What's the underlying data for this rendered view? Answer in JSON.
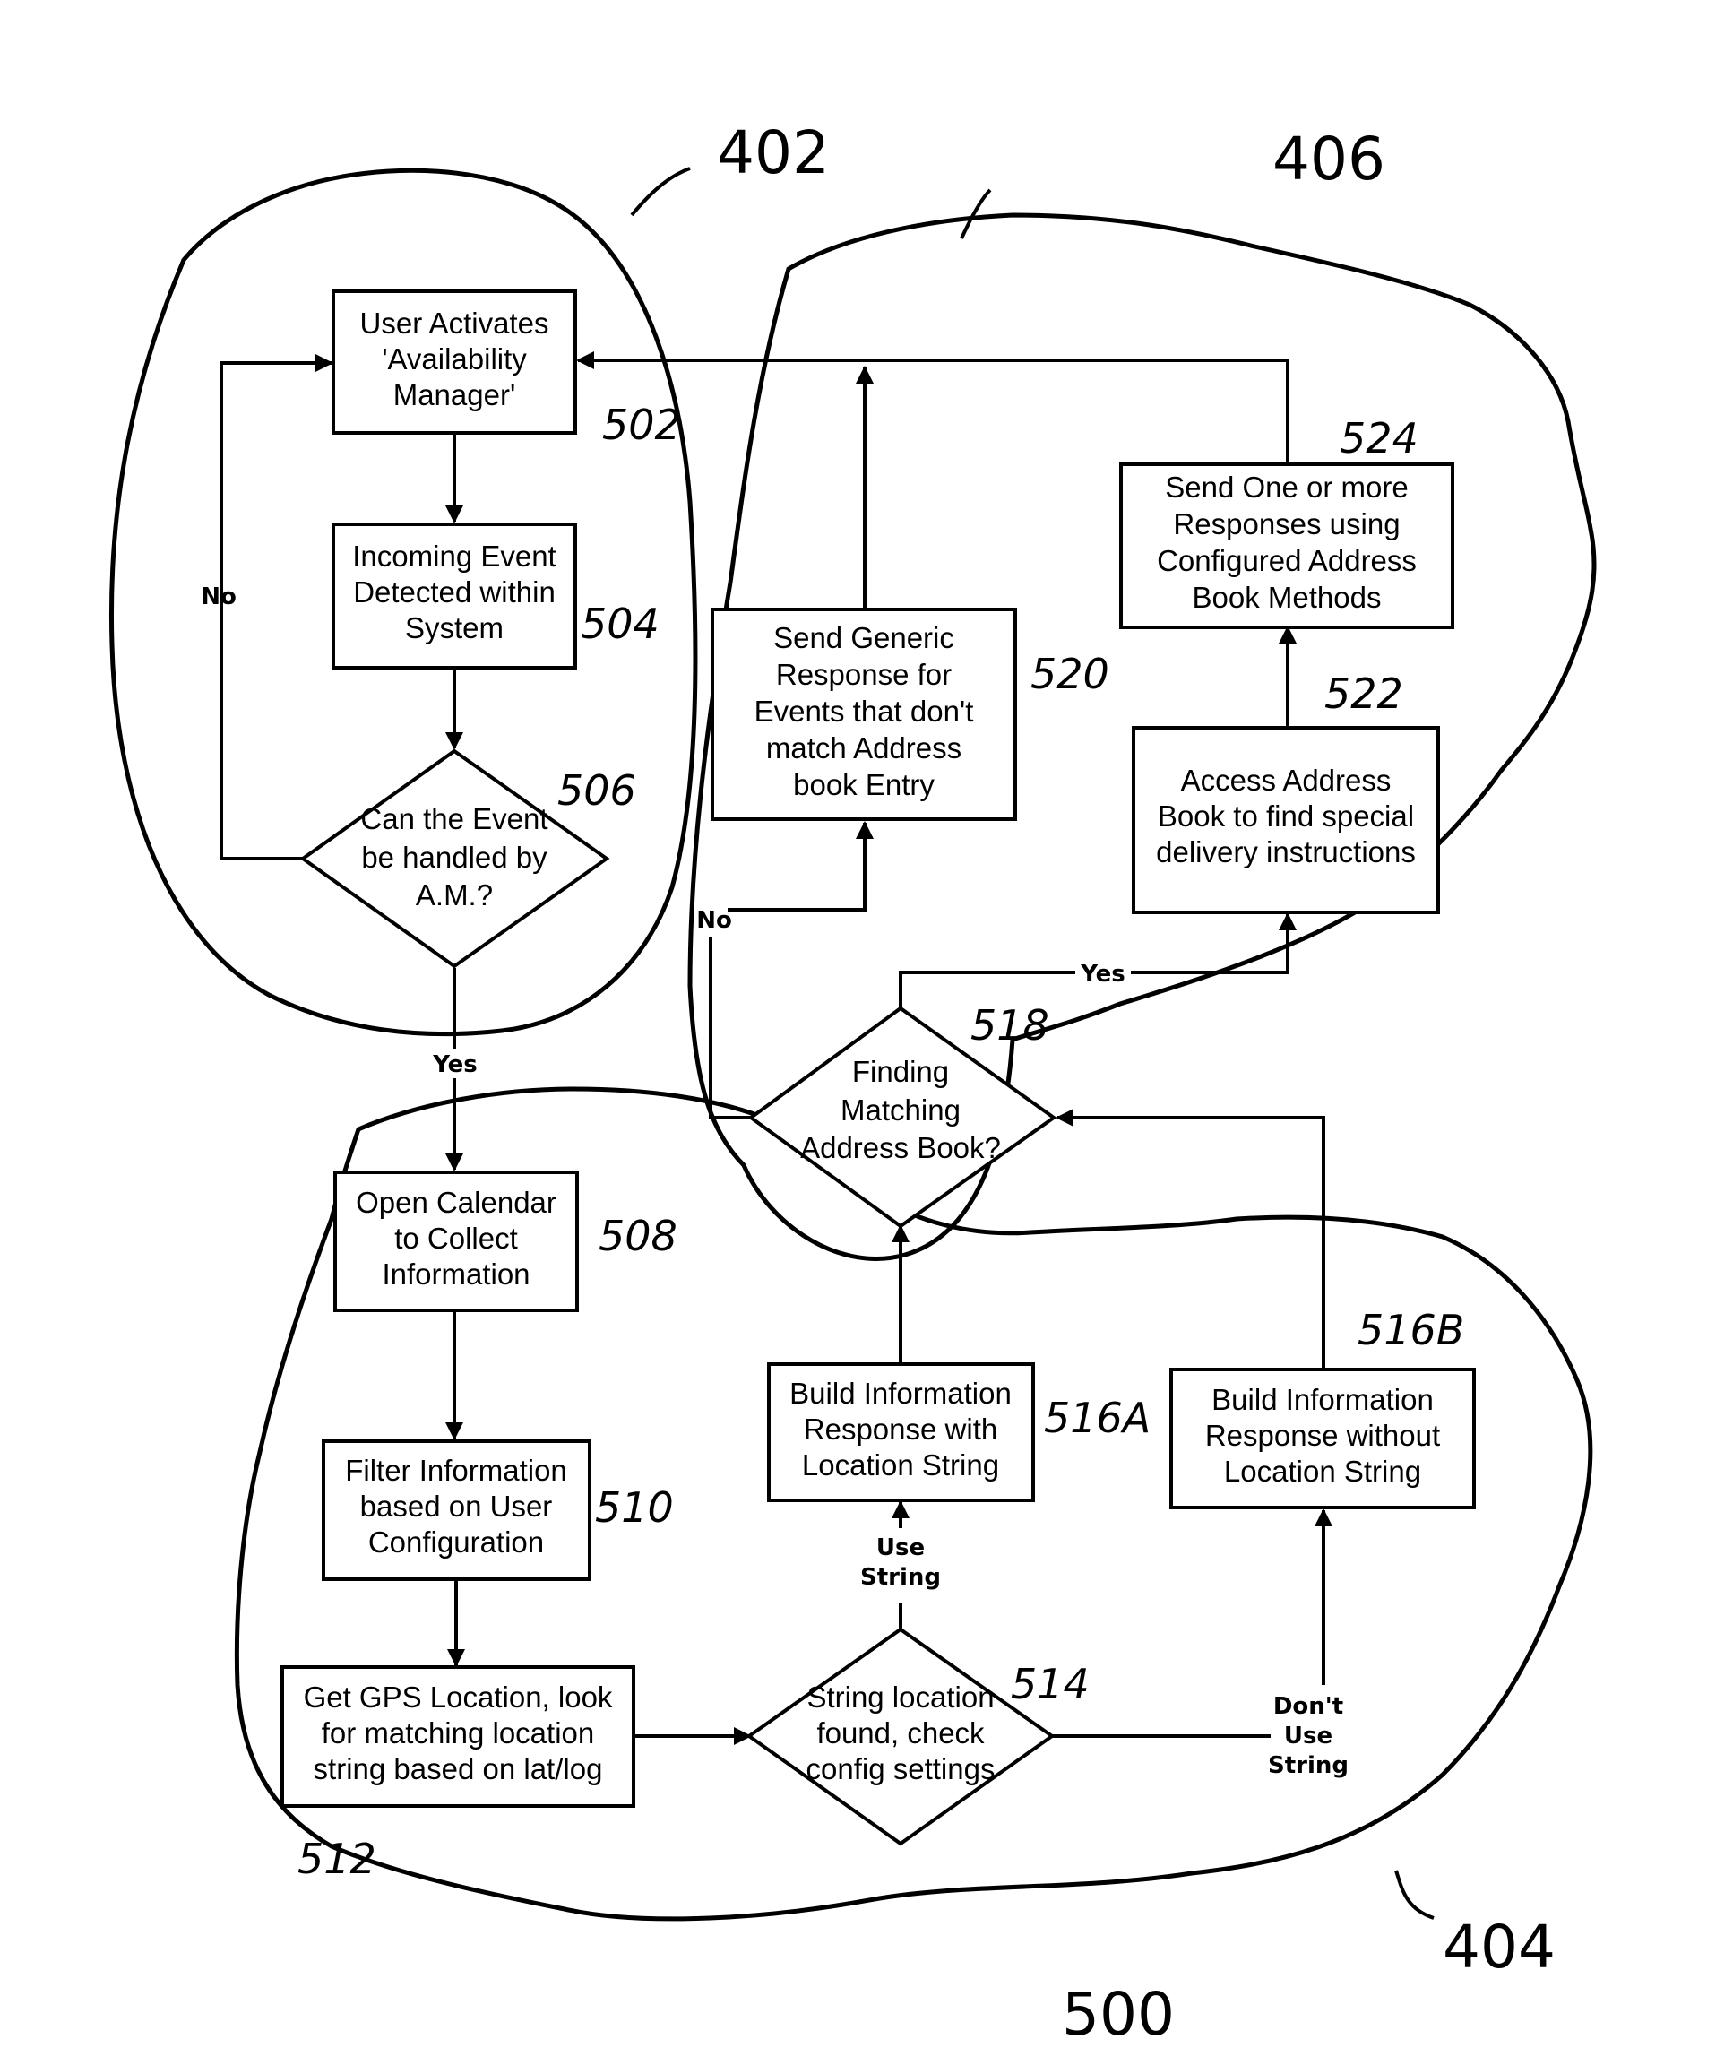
{
  "figure": {
    "figure_number": "500",
    "regions": [
      {
        "id": "402",
        "label": "402"
      },
      {
        "id": "404",
        "label": "404"
      },
      {
        "id": "406",
        "label": "406"
      }
    ],
    "nodes": [
      {
        "id": "502",
        "ref": "502",
        "shape": "process",
        "lines": [
          "User Activates",
          "'Availability",
          "Manager'"
        ]
      },
      {
        "id": "504",
        "ref": "504",
        "shape": "process",
        "lines": [
          "Incoming Event",
          "Detected within",
          "System"
        ]
      },
      {
        "id": "506",
        "ref": "506",
        "shape": "decision",
        "lines": [
          "Can the Event",
          "be handled by",
          "A.M.?"
        ]
      },
      {
        "id": "508",
        "ref": "508",
        "shape": "process",
        "lines": [
          "Open Calendar",
          "to Collect",
          "Information"
        ]
      },
      {
        "id": "510",
        "ref": "510",
        "shape": "process",
        "lines": [
          "Filter Information",
          "based on User",
          "Configuration"
        ]
      },
      {
        "id": "512",
        "ref": "512",
        "shape": "process",
        "lines": [
          "Get GPS Location, look",
          "for matching location",
          "string based on lat/log"
        ]
      },
      {
        "id": "514",
        "ref": "514",
        "shape": "decision",
        "lines": [
          "String location",
          "found, check",
          "config settings"
        ]
      },
      {
        "id": "516A",
        "ref": "516A",
        "shape": "process",
        "lines": [
          "Build Information",
          "Response with",
          "Location String"
        ]
      },
      {
        "id": "516B",
        "ref": "516B",
        "shape": "process",
        "lines": [
          "Build Information",
          "Response without",
          "Location String"
        ]
      },
      {
        "id": "518",
        "ref": "518",
        "shape": "decision",
        "lines": [
          "Finding",
          "Matching",
          "Address Book?"
        ]
      },
      {
        "id": "520",
        "ref": "520",
        "shape": "process",
        "lines": [
          "Send Generic",
          "Response for",
          "Events that don't",
          "match Address",
          "book Entry"
        ]
      },
      {
        "id": "522",
        "ref": "522",
        "shape": "process",
        "lines": [
          "Access Address",
          "Book to find special",
          "delivery instructions"
        ]
      },
      {
        "id": "524",
        "ref": "524",
        "shape": "process",
        "lines": [
          "Send One or more",
          "Responses using",
          "Configured Address",
          "Book Methods"
        ]
      }
    ],
    "edges": [
      {
        "from": "502",
        "to": "504",
        "label": ""
      },
      {
        "from": "504",
        "to": "506",
        "label": ""
      },
      {
        "from": "506",
        "to": "502",
        "label": "No"
      },
      {
        "from": "506",
        "to": "508",
        "label": "Yes"
      },
      {
        "from": "508",
        "to": "510",
        "label": ""
      },
      {
        "from": "510",
        "to": "512",
        "label": ""
      },
      {
        "from": "512",
        "to": "514",
        "label": ""
      },
      {
        "from": "514",
        "to": "516A",
        "label": "Use String"
      },
      {
        "from": "514",
        "to": "516B",
        "label": "Don't Use String"
      },
      {
        "from": "516A",
        "to": "518",
        "label": ""
      },
      {
        "from": "516B",
        "to": "518",
        "label": ""
      },
      {
        "from": "518",
        "to": "522",
        "label": "Yes"
      },
      {
        "from": "518",
        "to": "520",
        "label": "No"
      },
      {
        "from": "522",
        "to": "524",
        "label": ""
      },
      {
        "from": "524",
        "to": "502",
        "label": ""
      },
      {
        "from": "520",
        "to": "502",
        "label": ""
      }
    ],
    "edge_labels": {
      "no_506": "No",
      "yes_506": "Yes",
      "use_string_1": "Use",
      "use_string_2": "String",
      "dont_use_1": "Don't",
      "dont_use_2": "Use",
      "dont_use_3": "String",
      "yes_518": "Yes",
      "no_518": "No"
    }
  }
}
